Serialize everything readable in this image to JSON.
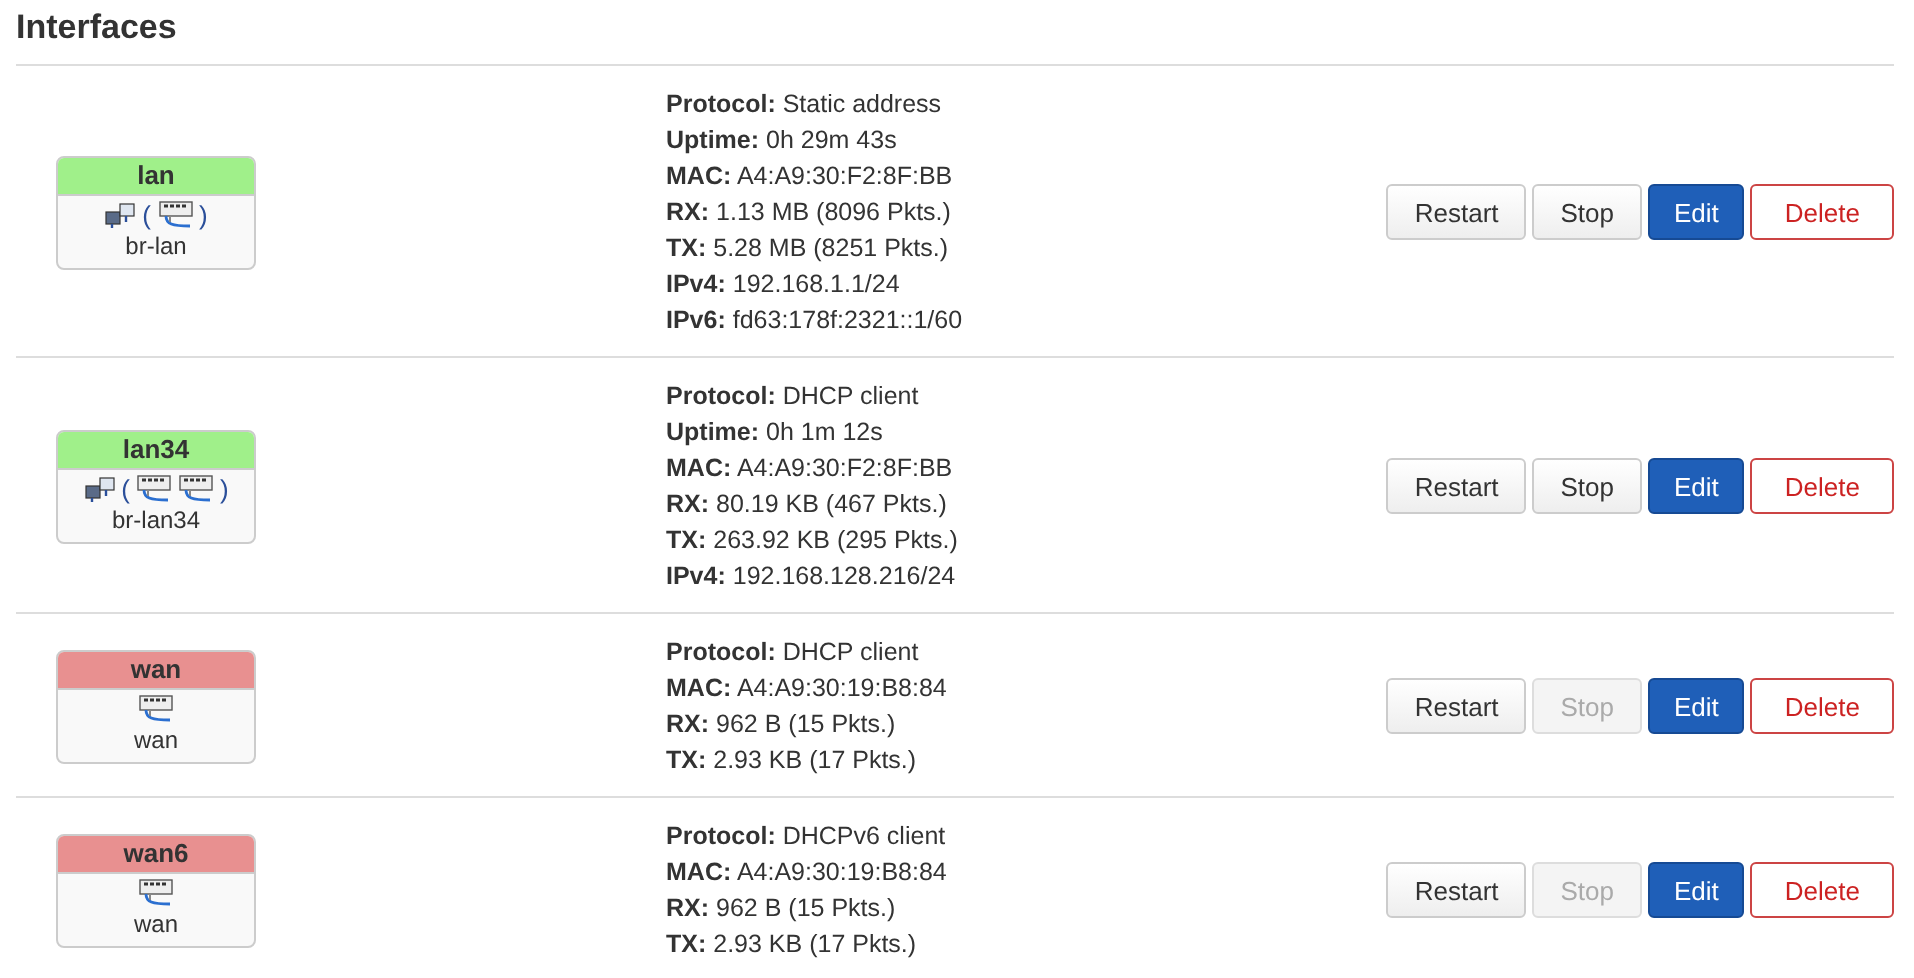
{
  "title": "Interfaces",
  "interfaces": [
    {
      "name": "lan",
      "color": "#a0f08a",
      "bridge": true,
      "open_bracket": "(",
      "close_bracket": ")",
      "ports": [
        {
          "kind": "ethernet"
        }
      ],
      "device": "br-lan",
      "details": [
        {
          "label": "Protocol:",
          "value": "Static address"
        },
        {
          "label": "Uptime:",
          "value": "0h 29m 43s"
        },
        {
          "label": "MAC:",
          "value": "A4:A9:30:F2:8F:BB"
        },
        {
          "label": "RX:",
          "value": "1.13 MB (8096 Pkts.)"
        },
        {
          "label": "TX:",
          "value": "5.28 MB (8251 Pkts.)"
        },
        {
          "label": "IPv4:",
          "value": "192.168.1.1/24"
        },
        {
          "label": "IPv6:",
          "value": "fd63:178f:2321::1/60"
        }
      ],
      "buttons": [
        {
          "label": "Restart",
          "kind": "default",
          "disabled": false
        },
        {
          "label": "Stop",
          "kind": "default",
          "disabled": false
        },
        {
          "label": "Edit",
          "kind": "primary",
          "disabled": false
        },
        {
          "label": "Delete",
          "kind": "danger",
          "disabled": false
        }
      ]
    },
    {
      "name": "lan34",
      "color": "#a0f08a",
      "bridge": true,
      "open_bracket": "(",
      "close_bracket": ")",
      "ports": [
        {
          "kind": "ethernet"
        },
        {
          "kind": "ethernet"
        }
      ],
      "device": "br-lan34",
      "details": [
        {
          "label": "Protocol:",
          "value": "DHCP client"
        },
        {
          "label": "Uptime:",
          "value": "0h 1m 12s"
        },
        {
          "label": "MAC:",
          "value": "A4:A9:30:F2:8F:BB"
        },
        {
          "label": "RX:",
          "value": "80.19 KB (467 Pkts.)"
        },
        {
          "label": "TX:",
          "value": "263.92 KB (295 Pkts.)"
        },
        {
          "label": "IPv4:",
          "value": "192.168.128.216/24"
        }
      ],
      "buttons": [
        {
          "label": "Restart",
          "kind": "default",
          "disabled": false
        },
        {
          "label": "Stop",
          "kind": "default",
          "disabled": false
        },
        {
          "label": "Edit",
          "kind": "primary",
          "disabled": false
        },
        {
          "label": "Delete",
          "kind": "danger",
          "disabled": false
        }
      ]
    },
    {
      "name": "wan",
      "color": "#e89090",
      "bridge": false,
      "ports": [
        {
          "kind": "ethernet"
        }
      ],
      "device": "wan",
      "details": [
        {
          "label": "Protocol:",
          "value": "DHCP client"
        },
        {
          "label": "MAC:",
          "value": "A4:A9:30:19:B8:84"
        },
        {
          "label": "RX:",
          "value": "962 B (15 Pkts.)"
        },
        {
          "label": "TX:",
          "value": "2.93 KB (17 Pkts.)"
        }
      ],
      "buttons": [
        {
          "label": "Restart",
          "kind": "default",
          "disabled": false
        },
        {
          "label": "Stop",
          "kind": "default",
          "disabled": true
        },
        {
          "label": "Edit",
          "kind": "primary",
          "disabled": false
        },
        {
          "label": "Delete",
          "kind": "danger",
          "disabled": false
        }
      ]
    },
    {
      "name": "wan6",
      "color": "#e89090",
      "bridge": false,
      "ports": [
        {
          "kind": "ethernet"
        }
      ],
      "device": "wan",
      "details": [
        {
          "label": "Protocol:",
          "value": "DHCPv6 client"
        },
        {
          "label": "MAC:",
          "value": "A4:A9:30:19:B8:84"
        },
        {
          "label": "RX:",
          "value": "962 B (15 Pkts.)"
        },
        {
          "label": "TX:",
          "value": "2.93 KB (17 Pkts.)"
        }
      ],
      "buttons": [
        {
          "label": "Restart",
          "kind": "default",
          "disabled": false
        },
        {
          "label": "Stop",
          "kind": "default",
          "disabled": true
        },
        {
          "label": "Edit",
          "kind": "primary",
          "disabled": false
        },
        {
          "label": "Delete",
          "kind": "danger",
          "disabled": false
        }
      ]
    }
  ]
}
